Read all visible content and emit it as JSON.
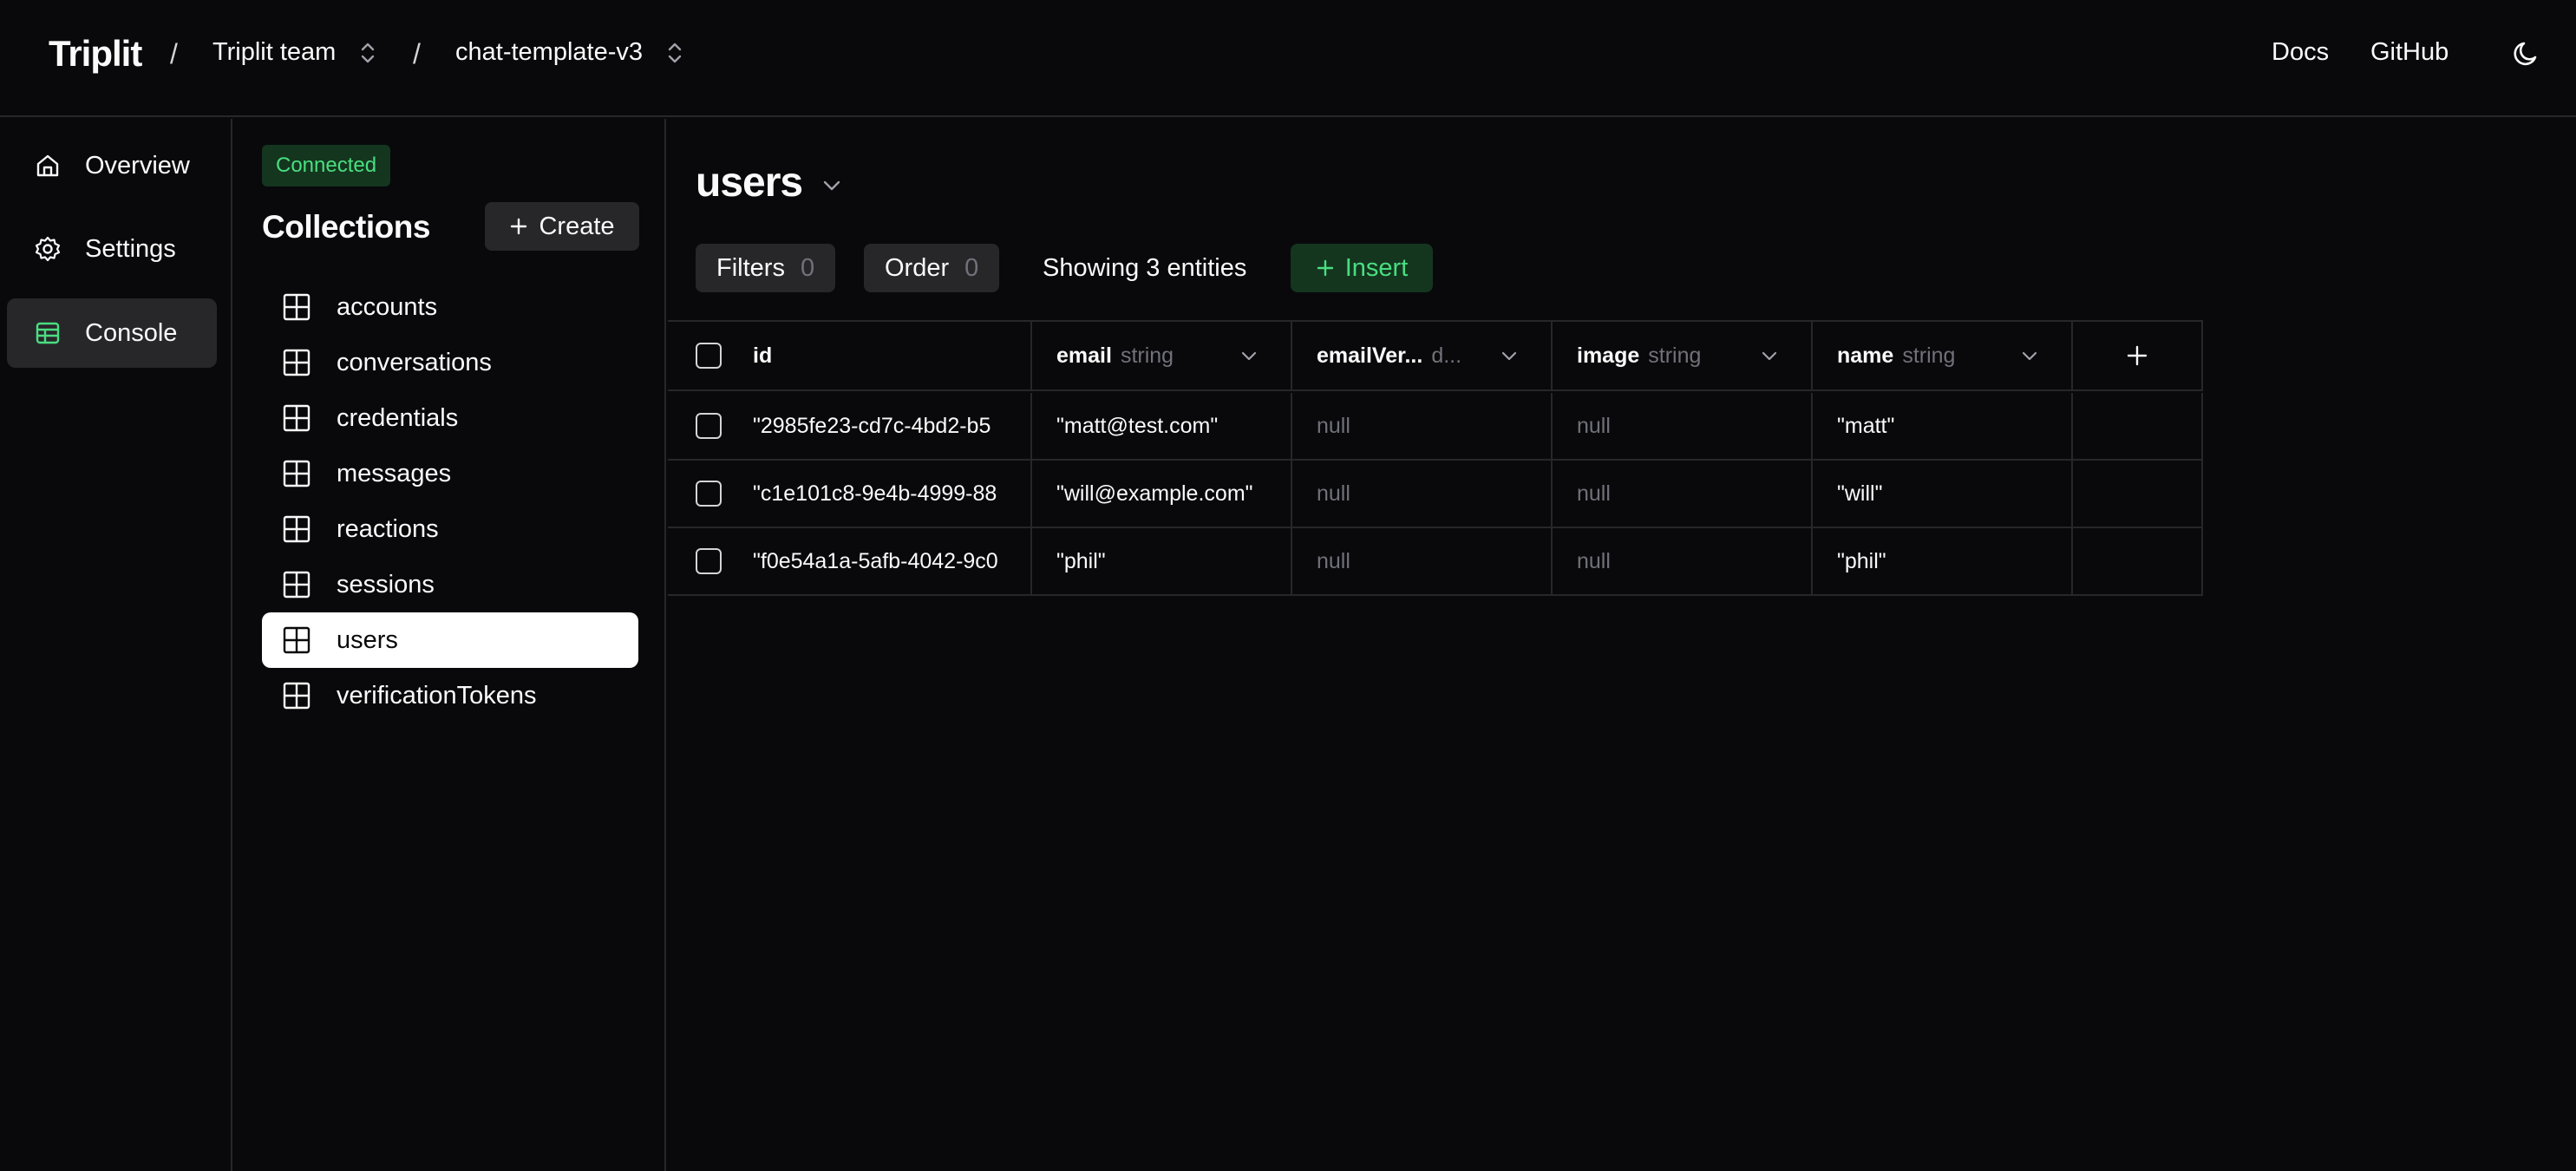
{
  "header": {
    "brand": "Triplit",
    "separator": "/",
    "team": "Triplit team",
    "project": "chat-template-v3",
    "docs": "Docs",
    "github": "GitHub"
  },
  "leftnav": {
    "items": [
      {
        "label": "Overview"
      },
      {
        "label": "Settings"
      },
      {
        "label": "Console"
      }
    ]
  },
  "collections": {
    "status": "Connected",
    "title": "Collections",
    "create_label": "Create",
    "items": [
      {
        "label": "accounts"
      },
      {
        "label": "conversations"
      },
      {
        "label": "credentials"
      },
      {
        "label": "messages"
      },
      {
        "label": "reactions"
      },
      {
        "label": "sessions"
      },
      {
        "label": "users"
      },
      {
        "label": "verificationTokens"
      }
    ],
    "selected": "users"
  },
  "main": {
    "title": "users",
    "filters_label": "Filters",
    "filters_count": "0",
    "order_label": "Order",
    "order_count": "0",
    "showing": "Showing 3 entities",
    "insert_label": "Insert",
    "table": {
      "columns": [
        {
          "name": "id",
          "type": ""
        },
        {
          "name": "email",
          "type": "string"
        },
        {
          "name": "emailVer...",
          "type": "d..."
        },
        {
          "name": "image",
          "type": "string"
        },
        {
          "name": "name",
          "type": "string"
        }
      ],
      "rows": [
        [
          "\"2985fe23-cd7c-4bd2-b5",
          "\"matt@test.com\"",
          "null",
          "null",
          "\"matt\""
        ],
        [
          "\"c1e101c8-9e4b-4999-88",
          "\"will@example.com\"",
          "null",
          "null",
          "\"will\""
        ],
        [
          "\"f0e54a1a-5afb-4042-9c0",
          "\"phil\"",
          "null",
          "null",
          "\"phil\""
        ]
      ]
    }
  },
  "colors": {
    "background": "#09090b",
    "border": "#27272a",
    "accent_green": "#4ade80",
    "accent_green_bg": "#14361f"
  },
  "icons": {
    "overview": "home-icon",
    "settings": "gear-icon",
    "console": "table-icon",
    "collection": "grid-icon",
    "theme": "moon-icon"
  }
}
